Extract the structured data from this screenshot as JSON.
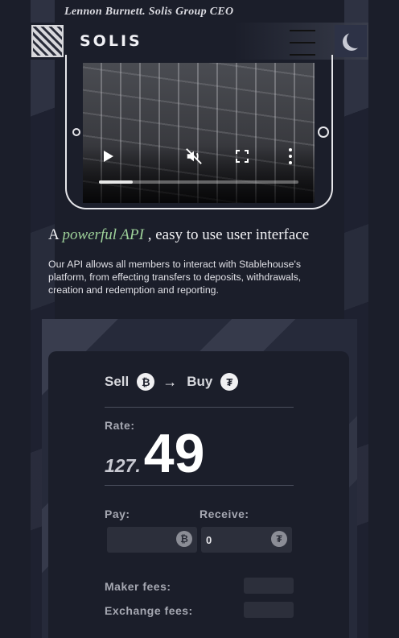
{
  "testimonial": {
    "text": "Lennon Burnett. Solis Group CEO"
  },
  "header": {
    "brand": "SOLIS",
    "menu_icon": "hamburger-menu-icon",
    "theme_icon": "moon-icon"
  },
  "video": {
    "controls": [
      "play-icon",
      "mute-icon",
      "fullscreen-icon",
      "more-icon"
    ],
    "progress": 0.17
  },
  "hero": {
    "headline_prefix": "A",
    "headline_accent": "powerful API",
    "headline_suffix": ", easy to use user interface",
    "description": "Our API allows all members to interact with Stablehouse's platform, from effecting transfers to deposits, withdrawals, creation and redemption and reporting."
  },
  "exchange": {
    "sell_label": "Sell",
    "sell_coin": "₿",
    "buy_label": "Buy",
    "buy_coin": "₮",
    "arrow": "→",
    "rate_label": "Rate:",
    "rate_integer": "127.",
    "rate_decimal": "49",
    "pay_label": "Pay:",
    "receive_label": "Receive:",
    "pay_value": "",
    "receive_value": "0",
    "maker_fees_label": "Maker fees:",
    "exchange_fees_label": "Exchange fees:",
    "colors": {
      "accent": "#9ed29a",
      "background": "#1b1e2a"
    }
  }
}
